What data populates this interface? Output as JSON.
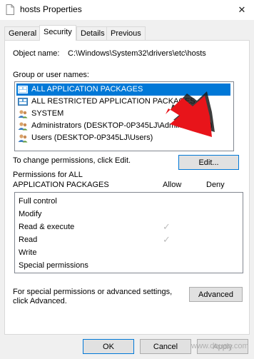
{
  "window": {
    "title": "hosts Properties",
    "close_glyph": "✕"
  },
  "tabs": [
    {
      "label": "General"
    },
    {
      "label": "Security"
    },
    {
      "label": "Details"
    },
    {
      "label": "Previous Versions"
    }
  ],
  "security": {
    "object_label": "Object name:",
    "object_value": "C:\\Windows\\System32\\drivers\\etc\\hosts",
    "group_label": "Group or user names:",
    "groups": [
      {
        "label": "ALL APPLICATION PACKAGES",
        "icon": "package-icon",
        "selected": true
      },
      {
        "label": "ALL RESTRICTED APPLICATION PACKAGES",
        "icon": "package-icon",
        "selected": false
      },
      {
        "label": "SYSTEM",
        "icon": "user-group-icon",
        "selected": false
      },
      {
        "label": "Administrators (DESKTOP-0P345LJ\\Administrators)",
        "icon": "user-group-icon",
        "selected": false
      },
      {
        "label": "Users (DESKTOP-0P345LJ\\Users)",
        "icon": "user-group-icon",
        "selected": false
      }
    ],
    "change_text": "To change permissions, click Edit.",
    "edit_label": "Edit...",
    "perms_title_1": "Permissions for ALL",
    "perms_title_2": "APPLICATION PACKAGES",
    "allow_header": "Allow",
    "deny_header": "Deny",
    "permissions": [
      {
        "name": "Full control",
        "allow": false,
        "deny": false
      },
      {
        "name": "Modify",
        "allow": false,
        "deny": false
      },
      {
        "name": "Read & execute",
        "allow": true,
        "deny": false
      },
      {
        "name": "Read",
        "allow": true,
        "deny": false
      },
      {
        "name": "Write",
        "allow": false,
        "deny": false
      },
      {
        "name": "Special permissions",
        "allow": false,
        "deny": false
      }
    ],
    "check_glyph": "✓",
    "advanced_text_1": "For special permissions or advanced settings,",
    "advanced_text_2": "click Advanced.",
    "advanced_label": "Advanced"
  },
  "footer": {
    "ok_label": "OK",
    "cancel_label": "Cancel",
    "apply_label": "Apply"
  },
  "watermark": "www.deuaq.com",
  "colors": {
    "selection": "#0078d7",
    "arrow": "#e8141a"
  }
}
